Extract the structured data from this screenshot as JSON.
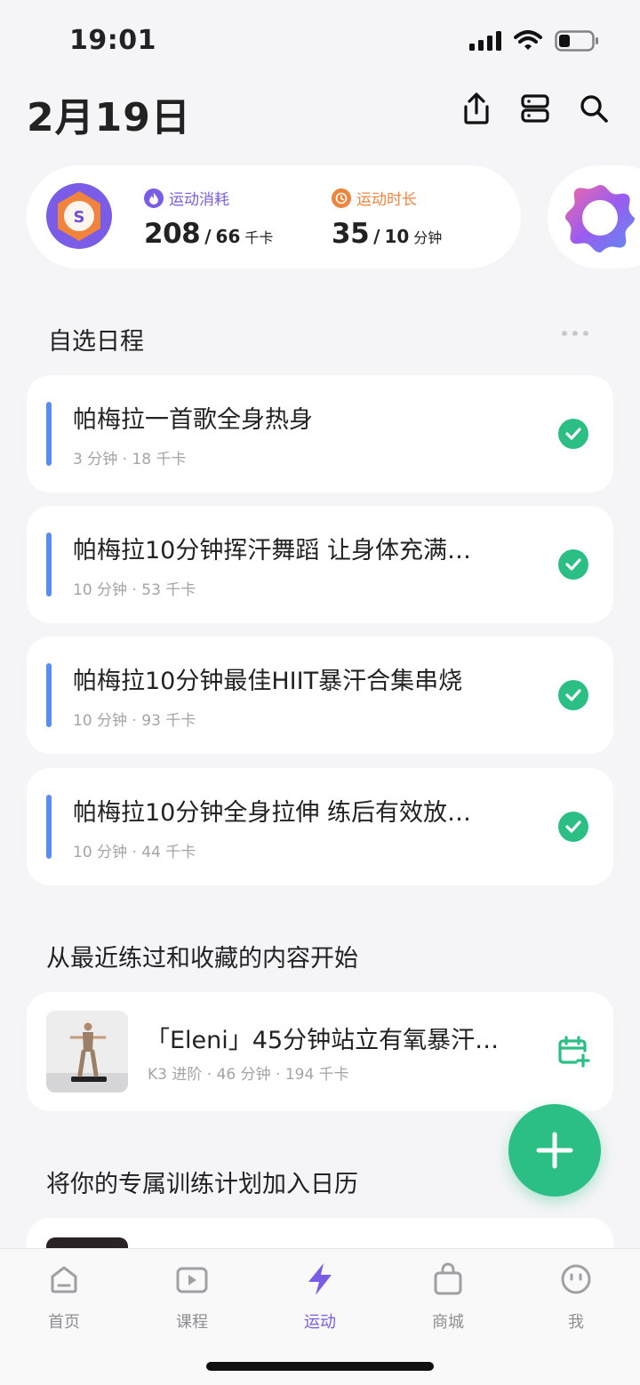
{
  "status_bar": {
    "time": "19:01"
  },
  "header": {
    "date": "2月19日"
  },
  "summary": {
    "calories": {
      "label": "运动消耗",
      "value": "208",
      "goal": "66",
      "unit": "千卡",
      "color": "#7b5ce6"
    },
    "duration": {
      "label": "运动时长",
      "value": "35",
      "goal": "10",
      "unit": "分钟",
      "color": "#f0843c"
    },
    "badge_letter": "S"
  },
  "schedule": {
    "title": "自选日程",
    "items": [
      {
        "title": "帕梅拉一首歌全身热身",
        "meta": "3 分钟 · 18 千卡",
        "completed": true
      },
      {
        "title": "帕梅拉10分钟挥汗舞蹈 让身体充满…",
        "meta": "10 分钟 · 53 千卡",
        "completed": true
      },
      {
        "title": "帕梅拉10分钟最佳HIIT暴汗合集串烧",
        "meta": "10 分钟 · 93 千卡",
        "completed": true
      },
      {
        "title": "帕梅拉10分钟全身拉伸 练后有效放…",
        "meta": "10 分钟 · 44 千卡",
        "completed": true
      }
    ]
  },
  "recent": {
    "title": "从最近练过和收藏的内容开始",
    "item": {
      "title": "「Eleni」45分钟站立有氧暴汗…",
      "meta": "K3 进阶 · 46 分钟 · 194 千卡"
    }
  },
  "plan": {
    "title": "将你的专属训练计划加入日历"
  },
  "tabs": [
    {
      "label": "首页",
      "icon": "home-icon"
    },
    {
      "label": "课程",
      "icon": "play-icon"
    },
    {
      "label": "运动",
      "icon": "bolt-icon",
      "active": true
    },
    {
      "label": "商城",
      "icon": "bag-icon"
    },
    {
      "label": "我",
      "icon": "face-icon"
    }
  ],
  "colors": {
    "accent": "#7b5ce6",
    "success": "#2bbf85",
    "bar": "#5b8def"
  }
}
